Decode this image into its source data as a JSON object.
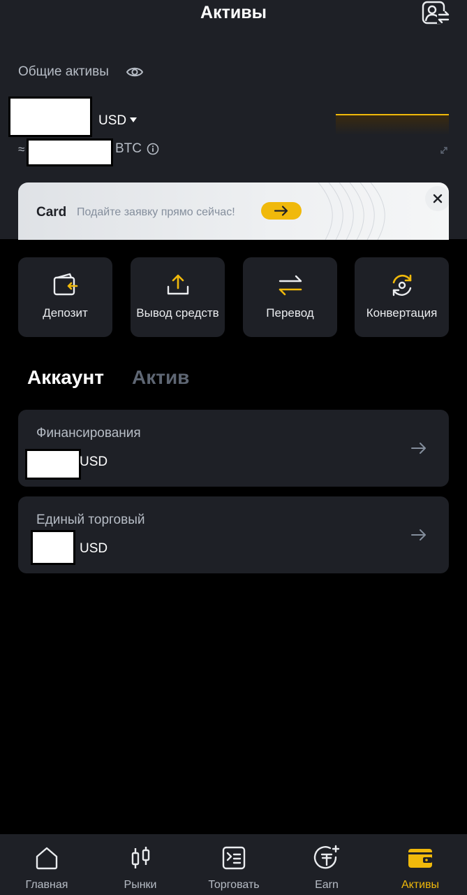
{
  "header": {
    "title": "Активы",
    "profile_icon": "profile-switch-icon"
  },
  "summary": {
    "total_label": "Общие активы",
    "visibility_icon": "eye-icon",
    "currency": "USD",
    "approx_symbol": "≈",
    "btc_unit": "BTC",
    "info_icon": "info-icon",
    "expand_icon": "expand-icon"
  },
  "banner": {
    "title": "Card",
    "text": "Подайте заявку прямо сейчас!",
    "arrow_icon": "arrow-right-icon",
    "close_icon": "close-icon"
  },
  "actions": [
    {
      "label": "Депозит",
      "icon": "deposit-icon"
    },
    {
      "label": "Вывод средств",
      "icon": "withdraw-icon"
    },
    {
      "label": "Перевод",
      "icon": "transfer-icon"
    },
    {
      "label": "Конвертация",
      "icon": "convert-icon"
    }
  ],
  "tabs": [
    {
      "label": "Аккаунт",
      "active": true
    },
    {
      "label": "Актив",
      "active": false
    }
  ],
  "accounts": [
    {
      "name": "Финансирования",
      "currency": "USD"
    },
    {
      "name": "Единый торговый",
      "currency": "USD"
    }
  ],
  "nav": [
    {
      "label": "Главная",
      "icon": "home-icon"
    },
    {
      "label": "Рынки",
      "icon": "markets-icon"
    },
    {
      "label": "Торговать",
      "icon": "trade-icon"
    },
    {
      "label": "Earn",
      "icon": "earn-icon"
    },
    {
      "label": "Активы",
      "icon": "wallet-icon",
      "active": true
    }
  ],
  "colors": {
    "accent": "#f0b90b",
    "background": "#000000",
    "surface": "#1e2026",
    "text_secondary": "#b7bdc6"
  }
}
